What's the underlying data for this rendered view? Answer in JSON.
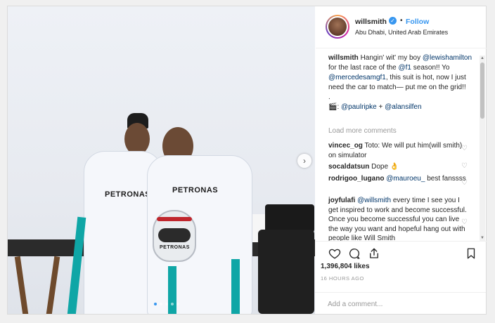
{
  "post": {
    "username": "willsmith",
    "location": "Abu Dhabi, United Arab Emirates",
    "follow_label": "Follow",
    "separator": "•",
    "verified_glyph": "✓",
    "caption": {
      "username": "willsmith",
      "text_1": " Hangin' wit' my boy ",
      "mention_1": "@lewishamilton",
      "text_2": " for the last race of the ",
      "mention_2": "@f1",
      "text_3": " season!! Yo ",
      "mention_3": "@mercedesamgf1",
      "text_4": ", this suit is hot, now I just need the car to match— put me on the grid!!",
      "dot_line": ".",
      "camera_glyph": "🎬",
      "mention_4": "@paulripke",
      "plus": " + ",
      "mention_5": "@alansilfen"
    },
    "load_more_label": "Load more comments",
    "comments": [
      {
        "username": "vincec_og",
        "text": " Toto: We will put him(will smith) on simulator"
      },
      {
        "username": "socaldatsun",
        "text": " Dope 👌"
      },
      {
        "username": "rodrigoo_lugano",
        "mention": "@mauroeu_",
        "text": " best fanssss"
      },
      {
        "username": "joyfulafi",
        "mention": "@willsmith",
        "text": " every time I see you I get inspired to work and become successful. Once you become successful you can live the way you want and hopeful hang out with people like Will Smith"
      }
    ],
    "likes": "1,396,804 likes",
    "timestamp": "16 HOURS AGO",
    "add_comment_placeholder": "Add a comment...",
    "photo_sponsor_1": "PETRONAS",
    "photo_sponsor_2": "PETRONAS",
    "photo_sponsor_3": "PETRONAS",
    "next_arrow_glyph": "›",
    "scroll_up_glyph": "▲",
    "scroll_down_glyph": "▼",
    "heart_glyph": "♡"
  },
  "icons": {
    "like": "heart-icon",
    "comment": "comment-icon",
    "share": "share-icon",
    "save": "bookmark-icon",
    "verified": "verified-badge-icon",
    "next": "chevron-right-icon"
  },
  "colors": {
    "accent": "#3897f0",
    "mention": "#003569",
    "muted": "#999999",
    "text": "#262626",
    "border": "#dbdbdb"
  },
  "carousel": {
    "slides": 5,
    "active": 1
  }
}
